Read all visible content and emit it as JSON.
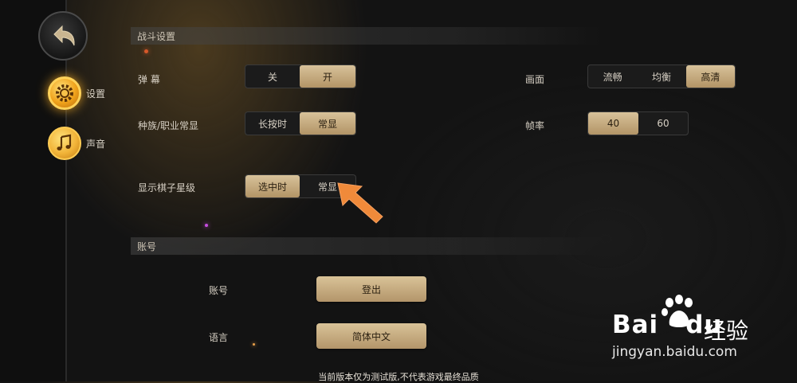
{
  "sidebar": {
    "back_icon": "back-arrow-icon",
    "items": [
      {
        "label": "设置",
        "icon": "gear-icon",
        "active": true
      },
      {
        "label": "声音",
        "icon": "music-note-icon",
        "active": false
      }
    ]
  },
  "battle": {
    "title": "战斗设置",
    "barrage": {
      "label": "弹 幕",
      "options": [
        "关",
        "开"
      ],
      "selected": "开"
    },
    "race": {
      "label": "种族/职业常显",
      "options": [
        "长按时",
        "常显"
      ],
      "selected": "常显"
    },
    "star": {
      "label": "显示棋子星级",
      "options": [
        "选中时",
        "常显"
      ],
      "selected": "选中时"
    },
    "quality": {
      "label": "画面",
      "options": [
        "流畅",
        "均衡",
        "高清"
      ],
      "selected": "高清"
    },
    "fps": {
      "label": "帧率",
      "options": [
        "40",
        "60"
      ],
      "selected": "40"
    }
  },
  "account": {
    "title": "账号",
    "account_label": "账号",
    "logout_label": "登出",
    "language_label": "语言",
    "language_value": "简体中文"
  },
  "footer": "当前版本仅为测试版,不代表游戏最终品质",
  "watermark": {
    "logo": "Bai",
    "logo_tail": "du",
    "cn": "经验",
    "url": "jingyan.baidu.com"
  },
  "colors": {
    "accent_gold": "#c9b07f",
    "background": "#131313",
    "arrow": "#f08a3a"
  }
}
